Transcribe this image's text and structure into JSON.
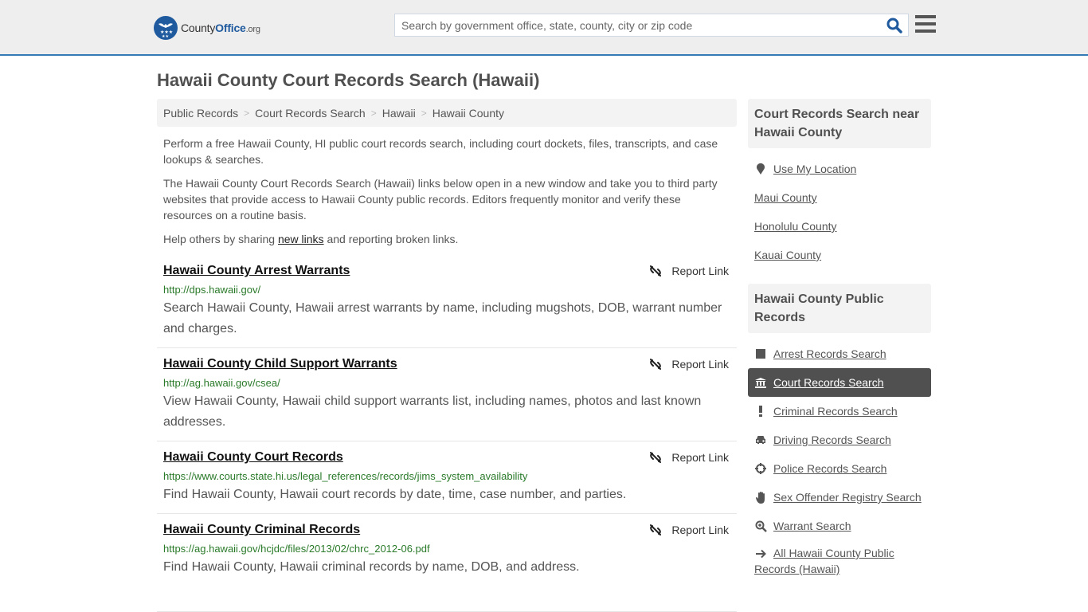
{
  "header": {
    "logo": {
      "name_part1": "County",
      "name_part2": "Office",
      "name_suffix": ".org"
    },
    "search": {
      "placeholder": "Search by government office, state, county, city or zip code",
      "value": ""
    },
    "colors": {
      "accent": "#337ab7",
      "brand": "#1f5a9e",
      "header_bg": "#eeeeee"
    }
  },
  "page": {
    "title": "Hawaii County Court Records Search (Hawaii)",
    "breadcrumb": [
      "Public Records",
      "Court Records Search",
      "Hawaii",
      "Hawaii County"
    ],
    "intro": {
      "p1": "Perform a free Hawaii County, HI public court records search, including court dockets, files, transcripts, and case lookups & searches.",
      "p2": "The Hawaii County Court Records Search (Hawaii) links below open in a new window and take you to third party websites that provide access to Hawaii County public records. Editors frequently monitor and verify these resources on a routine basis.",
      "p3_before": "Help others by sharing ",
      "p3_link": "new links",
      "p3_after": " and reporting broken links."
    },
    "report_label": "Report Link",
    "results": [
      {
        "title": "Hawaii County Arrest Warrants",
        "url": "http://dps.hawaii.gov/",
        "desc": "Search Hawaii County, Hawaii arrest warrants by name, including mugshots, DOB, warrant number and charges."
      },
      {
        "title": "Hawaii County Child Support Warrants",
        "url": "http://ag.hawaii.gov/csea/",
        "desc": "View Hawaii County, Hawaii child support warrants list, including names, photos and last known addresses."
      },
      {
        "title": "Hawaii County Court Records",
        "url": "https://www.courts.state.hi.us/legal_references/records/jims_system_availability",
        "desc": "Find Hawaii County, Hawaii court records by date, time, case number, and parties."
      },
      {
        "title": "Hawaii County Criminal Records",
        "url": "https://ag.hawaii.gov/hcjdc/files/2013/02/chrc_2012-06.pdf",
        "desc": "Find Hawaii County, Hawaii criminal records by name, DOB, and address."
      }
    ]
  },
  "sidebar": {
    "nearby": {
      "heading": "Court Records Search near Hawaii County",
      "use_location": "Use My Location",
      "items": [
        "Maui County",
        "Honolulu County",
        "Kauai County"
      ]
    },
    "public_records": {
      "heading": "Hawaii County Public Records",
      "items": [
        {
          "label": "Arrest Records Search",
          "icon": "square-icon",
          "active": false
        },
        {
          "label": "Court Records Search",
          "icon": "courthouse-icon",
          "active": true
        },
        {
          "label": "Criminal Records Search",
          "icon": "exclamation-icon",
          "active": false
        },
        {
          "label": "Driving Records Search",
          "icon": "car-icon",
          "active": false
        },
        {
          "label": "Police Records Search",
          "icon": "crosshairs-icon",
          "active": false
        },
        {
          "label": "Sex Offender Registry Search",
          "icon": "hand-icon",
          "active": false
        },
        {
          "label": "Warrant Search",
          "icon": "zoom-in-icon",
          "active": false
        },
        {
          "label": "All Hawaii County Public Records (Hawaii)",
          "icon": "arrow-right-icon",
          "active": false
        }
      ]
    }
  }
}
